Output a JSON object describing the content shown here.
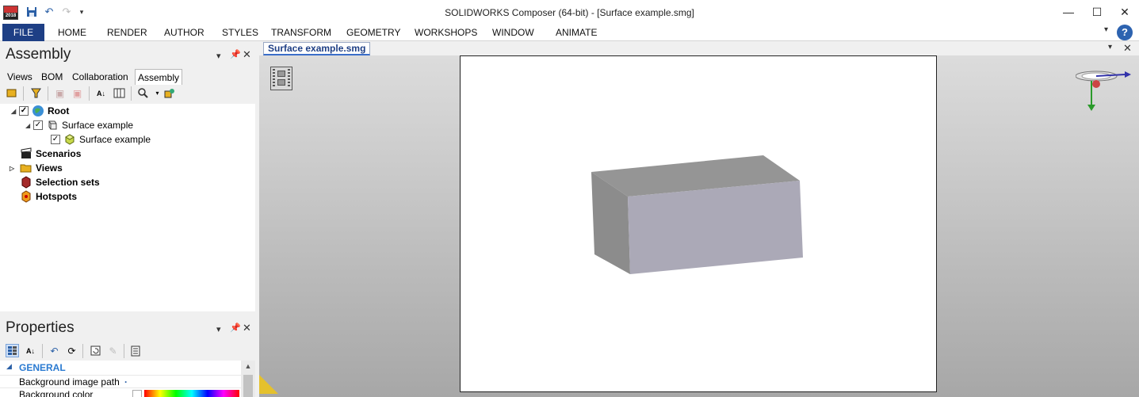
{
  "window": {
    "title": "SOLIDWORKS Composer (64-bit) - [Surface example.smg]",
    "logo_text": "2018",
    "minimize": "—",
    "maximize": "☐",
    "close": "✕"
  },
  "ribbon": {
    "file": "FILE",
    "tabs": [
      "HOME",
      "RENDER",
      "AUTHOR",
      "STYLES",
      "TRANSFORM",
      "GEOMETRY",
      "WORKSHOPS",
      "WINDOW",
      "ANIMATE"
    ],
    "help": "?"
  },
  "assembly_panel": {
    "title": "Assembly",
    "tabs": [
      "Views",
      "BOM",
      "Collaboration",
      "Assembly"
    ],
    "active_tab": "Assembly",
    "tree": [
      {
        "label": "Root",
        "bold": true,
        "expanded": true,
        "checked": true,
        "icon": "globe-icon"
      },
      {
        "label": "Surface example",
        "bold": false,
        "expanded": true,
        "checked": true,
        "icon": "assembly-icon"
      },
      {
        "label": "Surface example",
        "bold": false,
        "checked": true,
        "icon": "part-icon"
      },
      {
        "label": "Scenarios",
        "bold": true,
        "icon": "clapperboard-icon"
      },
      {
        "label": "Views",
        "bold": true,
        "collapsed": true,
        "icon": "folder-icon"
      },
      {
        "label": "Selection sets",
        "bold": true,
        "icon": "selection-set-icon"
      },
      {
        "label": "Hotspots",
        "bold": true,
        "icon": "hotspot-icon"
      }
    ]
  },
  "properties_panel": {
    "title": "Properties",
    "section": "GENERAL",
    "rows": [
      {
        "label": "Background image path",
        "value": "."
      },
      {
        "label": "Background color",
        "value": ""
      }
    ]
  },
  "document": {
    "tab": "Surface example.smg"
  },
  "colors": {
    "file_tab": "#1e3f85",
    "box_front": "#aba9b7",
    "box_top": "#959595",
    "box_side": "#8c8c8c",
    "viewport_top": "#dcdcdc",
    "viewport_bottom": "#a7a7a7"
  }
}
